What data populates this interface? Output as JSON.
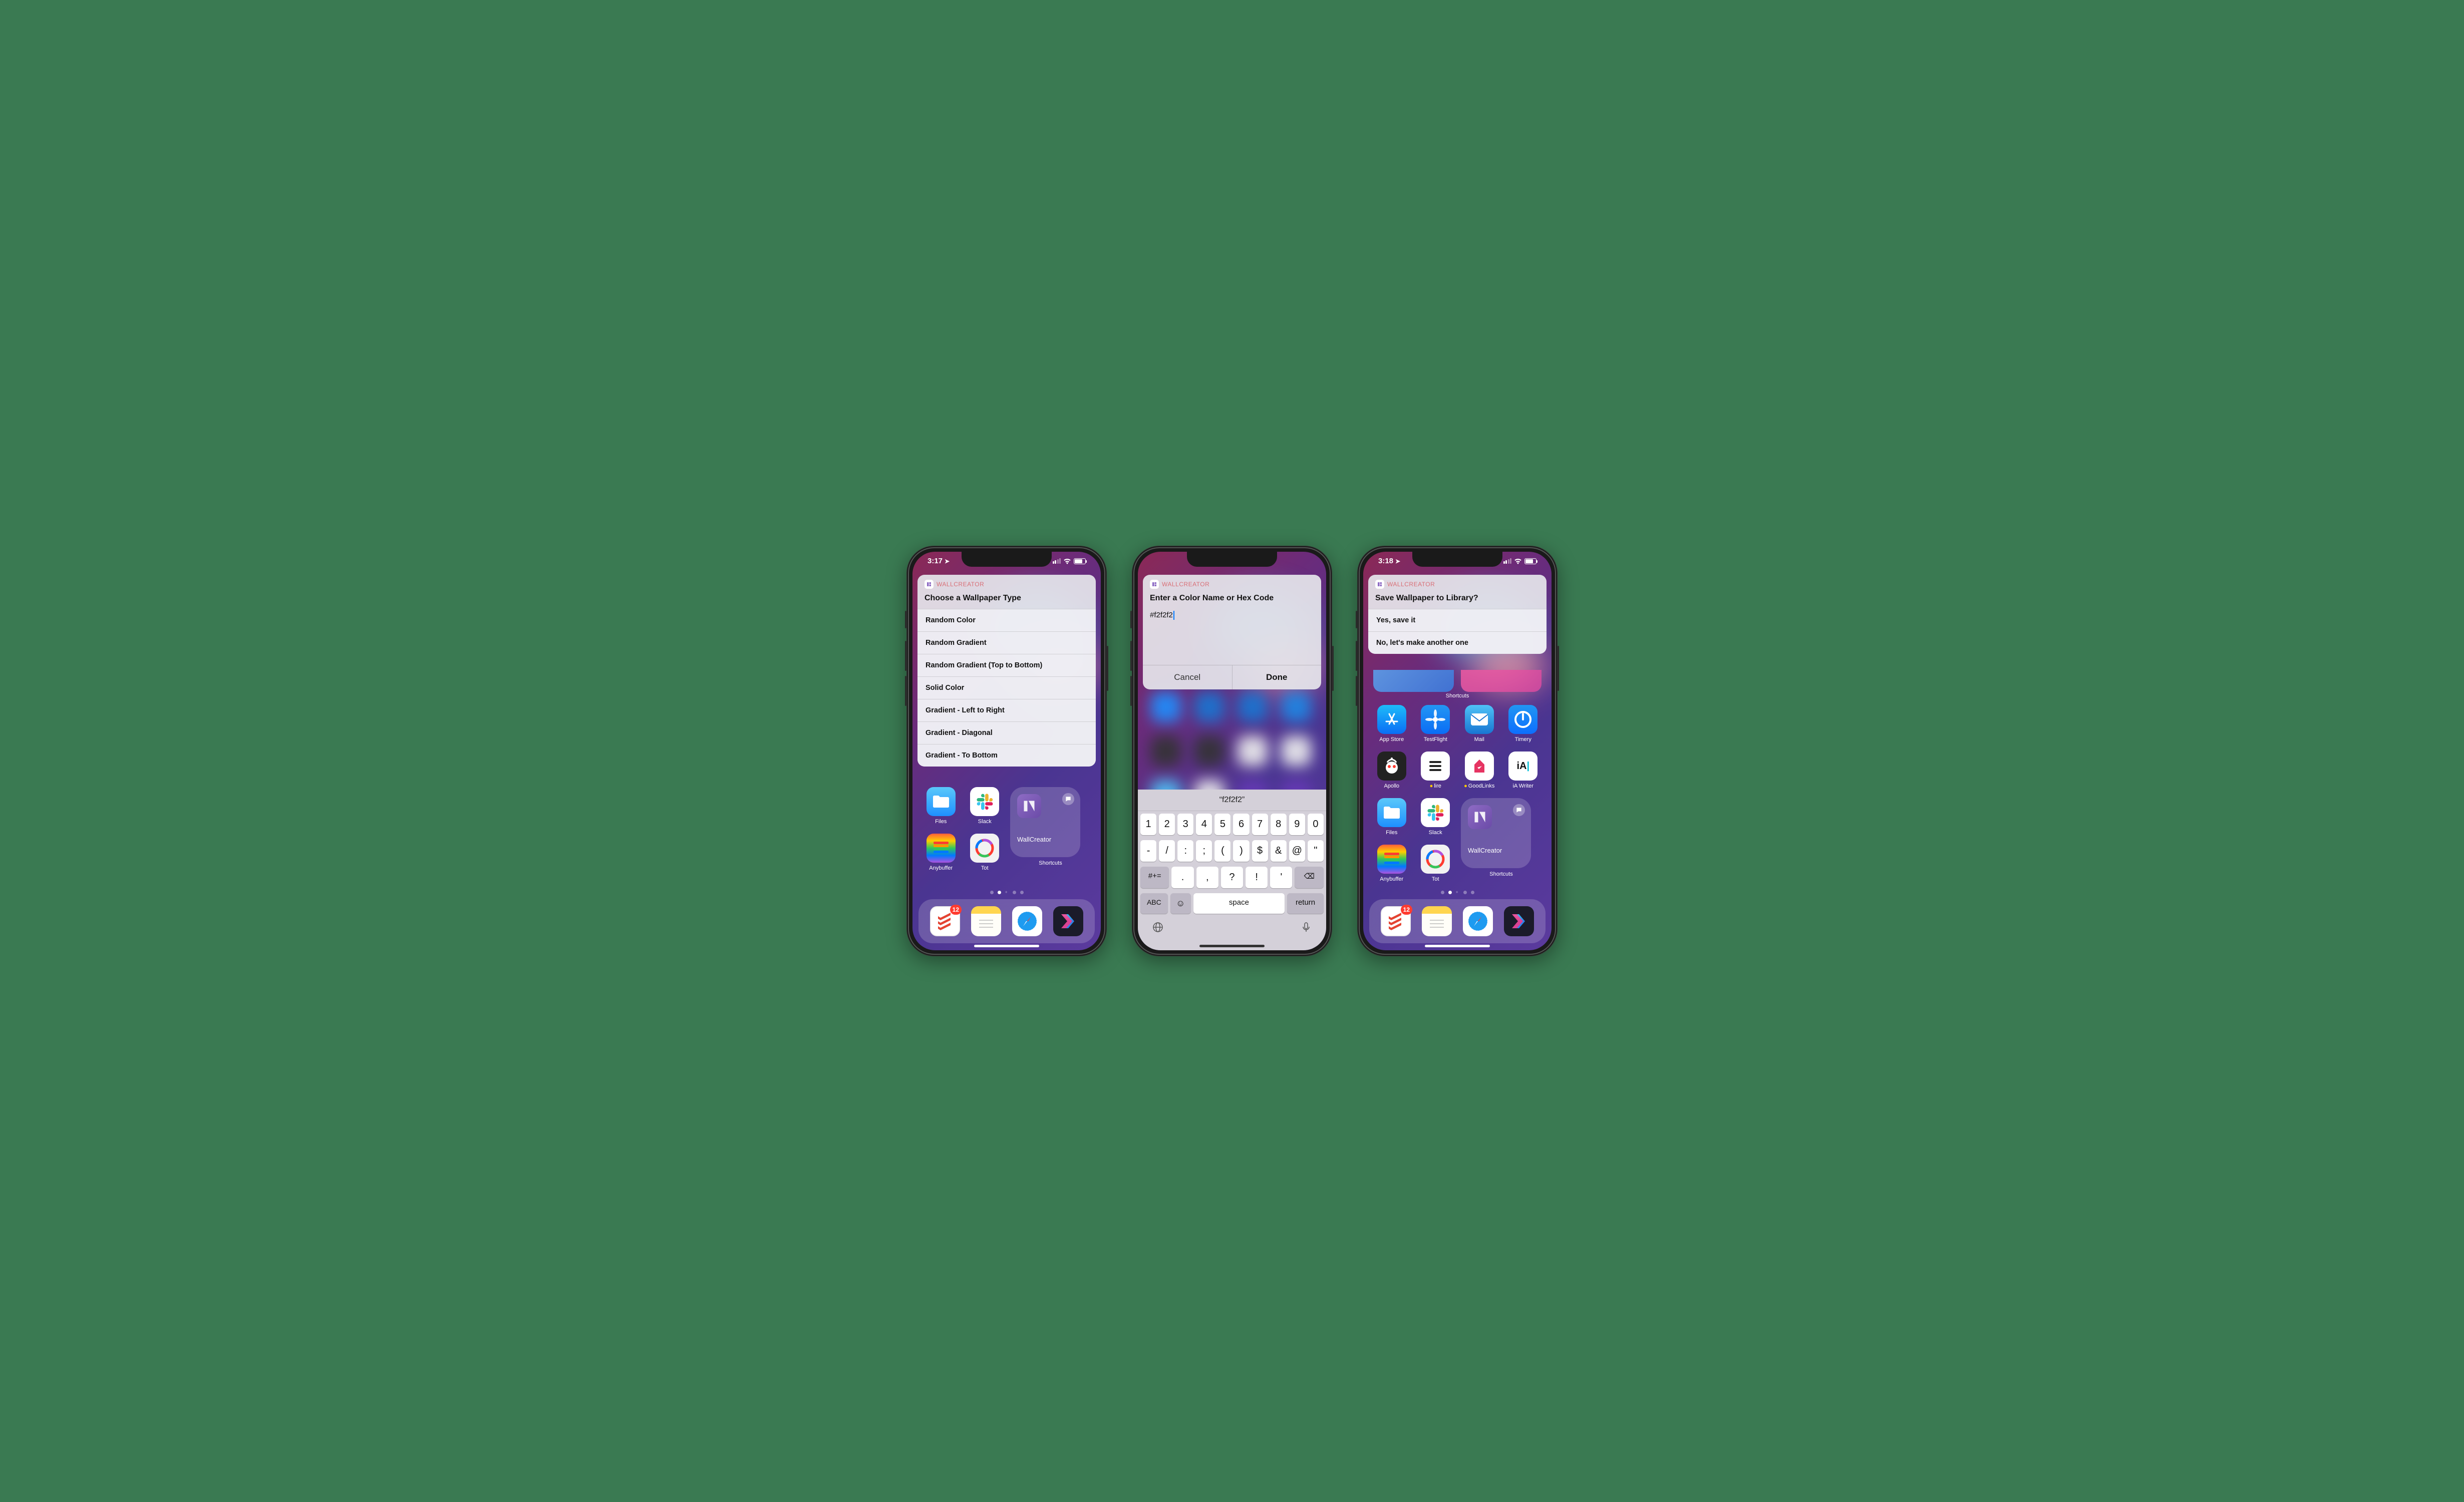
{
  "status": {
    "time1": "3:17",
    "time3": "3:18",
    "badge_count": "12"
  },
  "app": {
    "name": "WALLCREATOR"
  },
  "phone1": {
    "title": "Choose a Wallpaper Type",
    "options": [
      "Random Color",
      "Random Gradient",
      "Random Gradient (Top to Bottom)",
      "Solid Color",
      "Gradient - Left to Right",
      "Gradient - Diagonal",
      "Gradient - To Bottom"
    ]
  },
  "phone2": {
    "title": "Enter a Color Name or Hex Code",
    "input_value": "#f2f2f2",
    "cancel": "Cancel",
    "done": "Done",
    "suggestion": "“f2f2f2”",
    "keys_row1": [
      "1",
      "2",
      "3",
      "4",
      "5",
      "6",
      "7",
      "8",
      "9",
      "0"
    ],
    "keys_row2": [
      "-",
      "/",
      ":",
      ";",
      "(",
      ")",
      "$",
      "&",
      "@",
      "\""
    ],
    "keys_row3_mid": [
      ".",
      ",",
      "?",
      "!",
      "'"
    ],
    "key_symbols": "#+=",
    "key_backspace": "⌫",
    "key_abc": "ABC",
    "key_space": "space",
    "key_return": "return"
  },
  "phone3": {
    "title": "Save Wallpaper to Library?",
    "options": [
      "Yes, save it",
      "No, let's make another one"
    ]
  },
  "folder": {
    "wallcreator": "WallCreator",
    "shortcuts": "Shortcuts"
  },
  "apps": {
    "files": "Files",
    "slack": "Slack",
    "anybuffer": "Anybuffer",
    "tot": "Tot",
    "appstore": "App Store",
    "testflight": "TestFlight",
    "mail": "Mail",
    "timery": "Timery",
    "apollo": "Apollo",
    "lire": "lire",
    "goodlinks": "GoodLinks",
    "iawriter": "iA Writer"
  }
}
